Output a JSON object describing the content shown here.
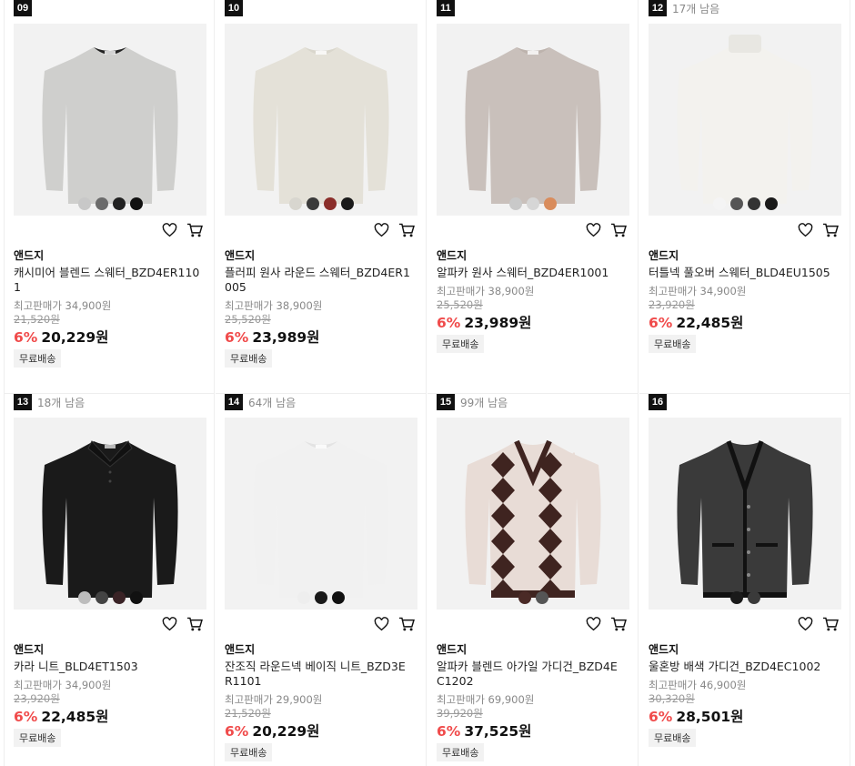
{
  "colors": {
    "discount": "#f04b4b",
    "rank_bg": "#111111",
    "card_bg": "#f2f2f2"
  },
  "icons": {
    "wishlist": "heart-icon",
    "cart": "cart-icon"
  },
  "products": [
    {
      "rank": "09",
      "stock": "",
      "brand": "앤드지",
      "name": "캐시미어 블렌드 스웨터_BZD4ER1101",
      "max_price": "최고판매가 34,900원",
      "original_price": "21,520원",
      "discount": "6%",
      "price": "20,229원",
      "badge": "무료배송",
      "swatches": [
        "#c8c8c8",
        "#6b6b6b",
        "#222222",
        "#111111"
      ],
      "garment": {
        "type": "crew",
        "color": "#cfcfcd",
        "collar": "#222222"
      }
    },
    {
      "rank": "10",
      "stock": "",
      "brand": "앤드지",
      "name": "플러피 원사 라운드 스웨터_BZD4ER1005",
      "max_price": "최고판매가 38,900원",
      "original_price": "25,520원",
      "discount": "6%",
      "price": "23,989원",
      "badge": "무료배송",
      "swatches": [
        "#d8d6cf",
        "#3a3a3a",
        "#8b2e2a",
        "#1a1a1a"
      ],
      "garment": {
        "type": "crew",
        "color": "#e4e1d8",
        "collar": "#d9d6cc"
      }
    },
    {
      "rank": "11",
      "stock": "",
      "brand": "앤드지",
      "name": "알파카 원사 스웨터_BZD4ER1001",
      "max_price": "최고판매가 38,900원",
      "original_price": "25,520원",
      "discount": "6%",
      "price": "23,989원",
      "badge": "무료배송",
      "swatches": [
        "#c9c9c9",
        "#d6d6d6",
        "#d98c5c"
      ],
      "garment": {
        "type": "crew",
        "color": "#c9c0bb",
        "collar": "#bdb3ad"
      }
    },
    {
      "rank": "12",
      "stock": "17개 남음",
      "brand": "앤드지",
      "name": "터틀넥 풀오버 스웨터_BLD4EU1505",
      "max_price": "최고판매가 34,900원",
      "original_price": "23,920원",
      "discount": "6%",
      "price": "22,485원",
      "badge": "무료배송",
      "swatches": [
        "#f4f4f4",
        "#555555",
        "#333333",
        "#1a1a1a"
      ],
      "garment": {
        "type": "turtle",
        "color": "#f3f2ee",
        "collar": "#e8e7e2"
      }
    },
    {
      "rank": "13",
      "stock": "18개 남음",
      "brand": "앤드지",
      "name": "카라 니트_BLD4ET1503",
      "max_price": "최고판매가 34,900원",
      "original_price": "23,920원",
      "discount": "6%",
      "price": "22,485원",
      "badge": "무료배송",
      "swatches": [
        "#bdbdbd",
        "#444444",
        "#3a2326",
        "#111111"
      ],
      "garment": {
        "type": "polo",
        "color": "#1a1a1a",
        "collar": "#111111"
      }
    },
    {
      "rank": "14",
      "stock": "64개 남음",
      "brand": "앤드지",
      "name": "잔조직 라운드넥 베이직 니트_BZD3ER1101",
      "max_price": "최고판매가 29,900원",
      "original_price": "21,520원",
      "discount": "6%",
      "price": "20,229원",
      "badge": "무료배송",
      "swatches": [
        "#eeeeee",
        "#1a1a1a",
        "#111111"
      ],
      "garment": {
        "type": "crew",
        "color": "#f1f1f1",
        "collar": "#e3e3e3"
      }
    },
    {
      "rank": "15",
      "stock": "99개 남음",
      "brand": "앤드지",
      "name": "알파카 블렌드 아가일 가디건_BZD4EC1202",
      "max_price": "최고판매가 69,900원",
      "original_price": "39,920원",
      "discount": "6%",
      "price": "37,525원",
      "badge": "무료배송",
      "swatches": [
        "#4a2a26",
        "#555555"
      ],
      "garment": {
        "type": "argyle",
        "color": "#e8dcd6",
        "collar": "#3f2420"
      }
    },
    {
      "rank": "16",
      "stock": "",
      "brand": "앤드지",
      "name": "울혼방 배색 가디건_BZD4EC1002",
      "max_price": "최고판매가 46,900원",
      "original_price": "30,320원",
      "discount": "6%",
      "price": "28,501원",
      "badge": "무료배송",
      "swatches": [
        "#1a1a1a",
        "#3a3a3a"
      ],
      "garment": {
        "type": "cardigan",
        "color": "#3a3a3a",
        "collar": "#111111"
      }
    }
  ]
}
